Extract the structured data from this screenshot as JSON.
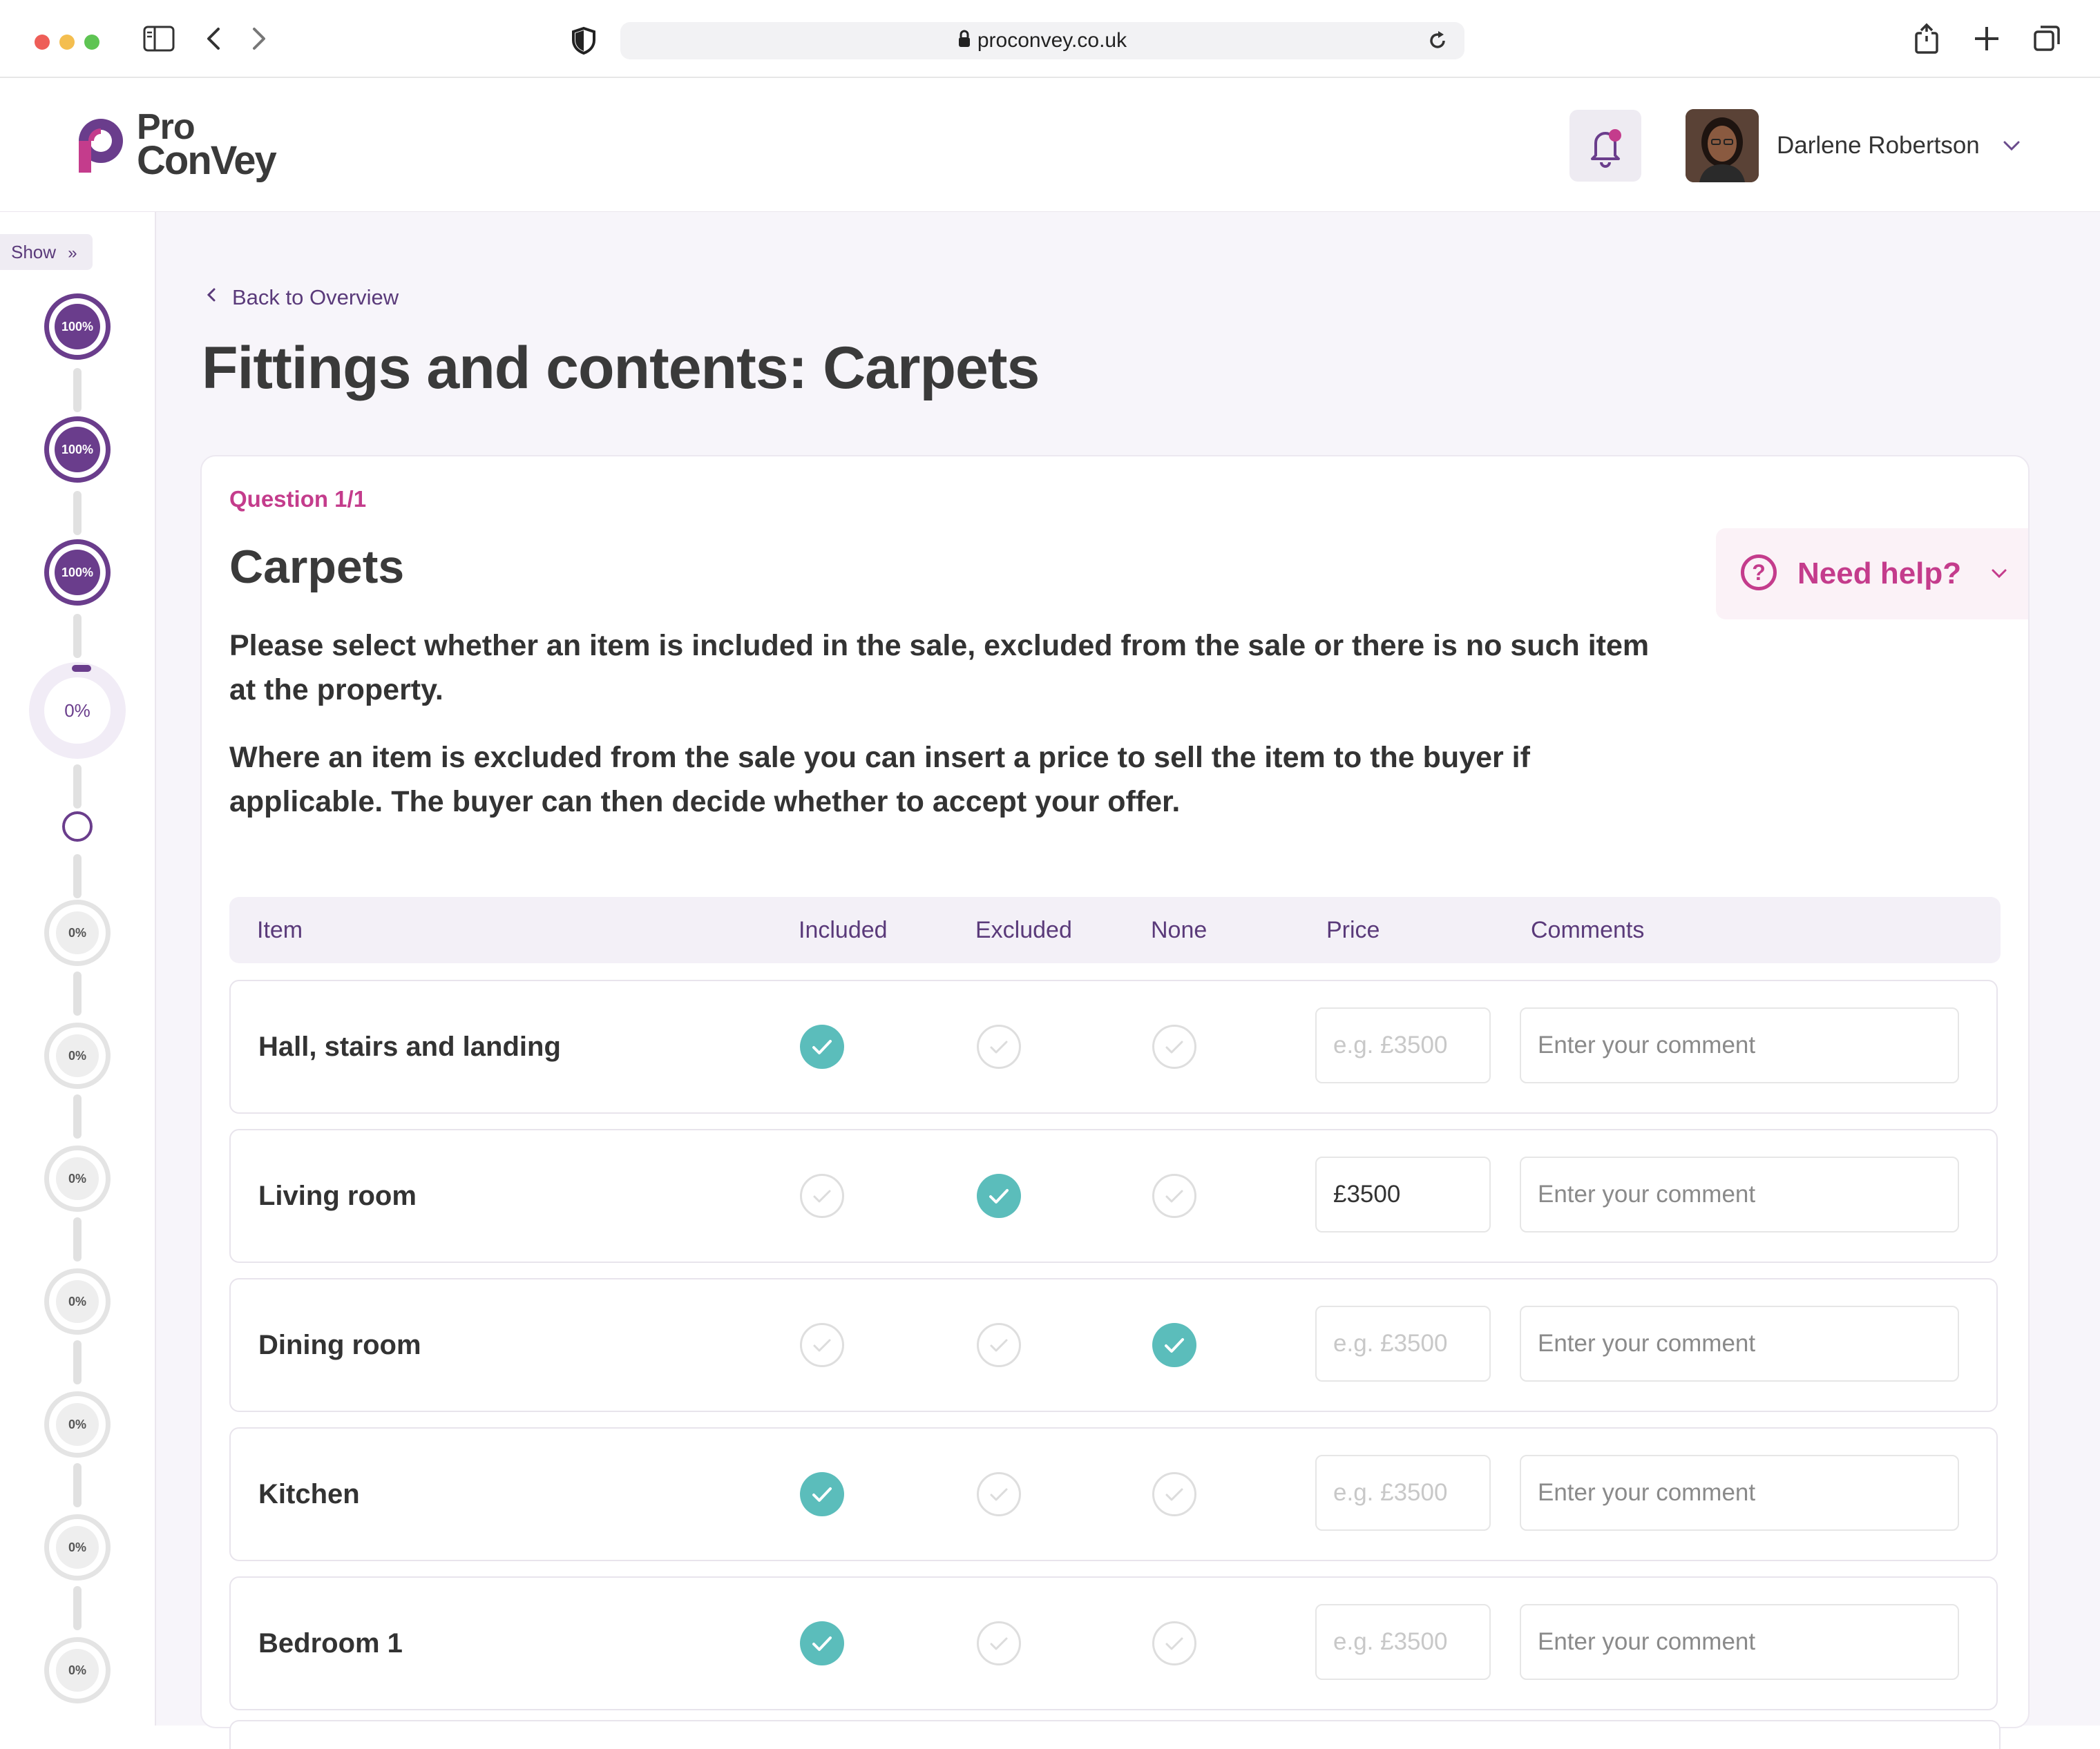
{
  "browser": {
    "url": "proconvey.co.uk"
  },
  "app": {
    "logo": {
      "line1": "Pro",
      "line2": "ConVey"
    },
    "user": {
      "name": "Darlene Robertson"
    }
  },
  "sidebar": {
    "show_label": "Show",
    "steps": [
      {
        "label": "100%",
        "state": "complete",
        "progress": 1.0
      },
      {
        "label": "100%",
        "state": "complete",
        "progress": 1.0
      },
      {
        "label": "100%",
        "state": "complete",
        "progress": 1.0
      },
      {
        "label": "0%",
        "state": "current",
        "progress": 0.0
      },
      {
        "label": "",
        "state": "substep",
        "progress": 0.0
      },
      {
        "label": "0%",
        "state": "pending",
        "progress": 0.0
      },
      {
        "label": "0%",
        "state": "pending",
        "progress": 0.0
      },
      {
        "label": "0%",
        "state": "pending",
        "progress": 0.0
      },
      {
        "label": "0%",
        "state": "pending",
        "progress": 0.0
      },
      {
        "label": "0%",
        "state": "pending",
        "progress": 0.0
      },
      {
        "label": "0%",
        "state": "pending",
        "progress": 0.0
      },
      {
        "label": "0%",
        "state": "pending",
        "progress": 0.0
      }
    ]
  },
  "page": {
    "back_label": "Back to Overview",
    "title": "Fittings and contents: Carpets"
  },
  "question": {
    "number": "Question 1/1",
    "title": "Carpets",
    "description_1": "Please select whether an item is included in the sale, excluded from the sale or there is no such item at the property.",
    "description_2": "Where an item is excluded from the sale you can insert a price to sell the item to the buyer if applicable. The buyer can then decide whether to accept your offer.",
    "help_label": "Need help?"
  },
  "table": {
    "headers": {
      "item": "Item",
      "included": "Included",
      "excluded": "Excluded",
      "none": "None",
      "price": "Price",
      "comments": "Comments"
    },
    "price_placeholder": "e.g. £3500",
    "comment_placeholder": "Enter your comment",
    "rows": [
      {
        "item": "Hall, stairs and landing",
        "selection": "included",
        "price": "",
        "comment": ""
      },
      {
        "item": "Living room",
        "selection": "excluded",
        "price": "£3500",
        "comment": ""
      },
      {
        "item": "Dining room",
        "selection": "none",
        "price": "",
        "comment": ""
      },
      {
        "item": "Kitchen",
        "selection": "included",
        "price": "",
        "comment": ""
      },
      {
        "item": "Bedroom 1",
        "selection": "included",
        "price": "",
        "comment": ""
      }
    ]
  },
  "colors": {
    "brand_purple": "#6a3d8c",
    "brand_pink": "#c43c8c",
    "check_teal": "#5bbdbb",
    "background": "#f7f5fa"
  }
}
